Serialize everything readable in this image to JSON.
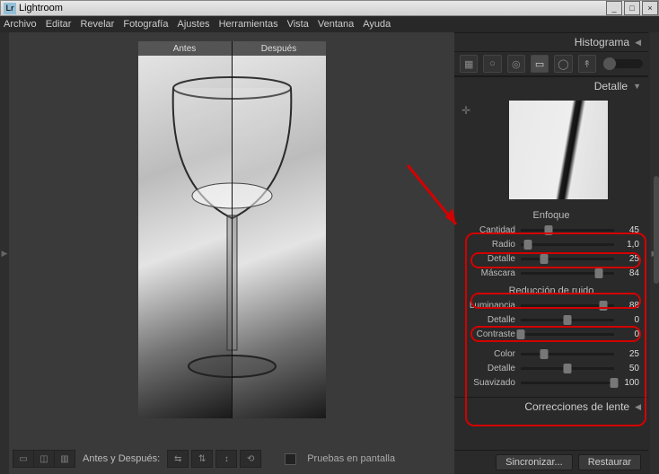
{
  "app": {
    "title": "Lightroom",
    "badge": "Lr"
  },
  "menu": [
    "Archivo",
    "Editar",
    "Revelar",
    "Fotografía",
    "Ajustes",
    "Herramientas",
    "Vista",
    "Ventana",
    "Ayuda"
  ],
  "winbtns": {
    "min": "_",
    "max": "□",
    "close": "×"
  },
  "compare": {
    "before": "Antes",
    "after": "Después"
  },
  "bottombar": {
    "before_after": "Antes y Después:",
    "softproof": "Pruebas en pantalla"
  },
  "panels": {
    "histogram": "Histograma",
    "detail": "Detalle",
    "lens": "Correcciones de lente"
  },
  "detail": {
    "sharpen_title": "Enfoque",
    "noise_title": "Reducción de ruido",
    "sharpen": [
      {
        "label": "Cantidad",
        "value": 45,
        "pos": 30
      },
      {
        "label": "Radio",
        "value": "1,0",
        "pos": 8
      },
      {
        "label": "Detalle",
        "value": 25,
        "pos": 25
      },
      {
        "label": "Máscara",
        "value": 84,
        "pos": 84
      }
    ],
    "noise_lum": [
      {
        "label": "Luminancia",
        "value": 88,
        "pos": 88
      },
      {
        "label": "Detalle",
        "value": 0,
        "pos": 50
      },
      {
        "label": "Contraste",
        "value": 0,
        "pos": 0
      }
    ],
    "noise_col": [
      {
        "label": "Color",
        "value": 25,
        "pos": 25
      },
      {
        "label": "Detalle",
        "value": 50,
        "pos": 50
      },
      {
        "label": "Suavizado",
        "value": 100,
        "pos": 100
      }
    ]
  },
  "buttons": {
    "sync": "Sincronizar...",
    "reset": "Restaurar"
  },
  "icons": {
    "grid": "▦",
    "loupe": "○",
    "spot": "◎",
    "eye": "◉",
    "grad": "▭",
    "radial": "◯",
    "brush": "↟",
    "v1": "▭",
    "v2": "◫",
    "v3": "▥",
    "ba1": "⇆",
    "ba2": "⇅",
    "ba3": "↕",
    "ba4": "⟲",
    "tri_left": "◀",
    "tri_right": "▶",
    "tri_down": "▼",
    "target": "✛"
  }
}
